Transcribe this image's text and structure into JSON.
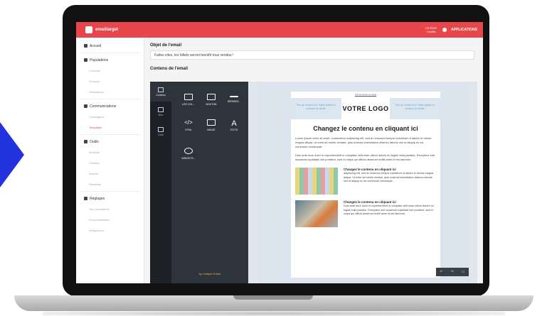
{
  "topbar": {
    "brand": "emailtarget",
    "credits": "CR ÉDIT\nCrédits",
    "apps": "APPLICATIONS"
  },
  "sidebar": {
    "items": [
      {
        "label": "Accueil",
        "icon": "home-icon",
        "subs": []
      },
      {
        "label": "Populations",
        "icon": "users-icon",
        "subs": [
          "Contacts",
          "Groupes",
          "Statistiques"
        ]
      },
      {
        "label": "Communications",
        "icon": "megaphone-icon",
        "subs": [
          "Campagnes",
          "Templates"
        ]
      },
      {
        "label": "Outils",
        "icon": "tools-icon",
        "subs": [
          "Modèles",
          "Création",
          "Imports",
          "Résultats"
        ]
      },
      {
        "label": "Réglages",
        "icon": "gear-icon",
        "subs": [
          "Tout paramètres",
          "Personnalisation",
          "Intégrations"
        ]
      }
    ]
  },
  "main": {
    "subject_label": "Objet de l'email",
    "subject_value": "Faites vites, les billets seront bientôt tous vendus !",
    "content_label": "Contenu de l'email"
  },
  "editor": {
    "tabs": [
      "Contenu",
      "Bloc",
      "Code"
    ],
    "blocks": [
      "LES COL...",
      "BOUTON",
      "SÉPARAT...",
      "HTML",
      "IMAGE",
      "TEXTE",
      "WIDGETS..."
    ],
    "footer": "by Unlayer Editor"
  },
  "email": {
    "view_in_browser": "Voir la version en ligne",
    "header_side": "Pas de contenu ici. Faites glisser le contenu de droite.",
    "logo": "VOTRE LOGO",
    "title": "Changez le contenu en cliquant ici",
    "para1": "Lorem ipsum dolor sit amet, consectetur adipiscing elit, sed do eiusmod tempor incididunt ut labore et dolore magna aliqua. Ut enim ad minim veniam, quis nostrud exercitation ullamco laboris nisi ut aliquip ex ea commodo consequat.",
    "para2": "Duis aute irure dolor in reprehenderit in voluptate velit esse cillum dolore eu fugiat nulla pariatur. Excepteur sint occaecat cupidatat non proident, sunt in culpa qui officia deserunt mollit anim id est laborum.",
    "item1_title": "Changez le contenu en cliquant ici",
    "item1_body": "adipiscing elit, sed do eiusmod tempor incididunt ut labore et dolore magna aliqua. Ut enim ad minim veniam, quis nostrud exercitation ullamco laboris nisi ut aliquip ex ea commodo consequat.",
    "item2_title": "Changez le contenu en cliquant ici",
    "item2_body": "Duis aute irure dolor in reprehenderit in voluptate velit esse cillum dolore eu fugiat nulla pariatur. Excepteur sint occaecat cupidatat non proident, sunt in culpa qui officia deserunt mollit anim id est laborum."
  },
  "colors": {
    "brand": "#e8464a",
    "arrow": "#2233dd"
  }
}
